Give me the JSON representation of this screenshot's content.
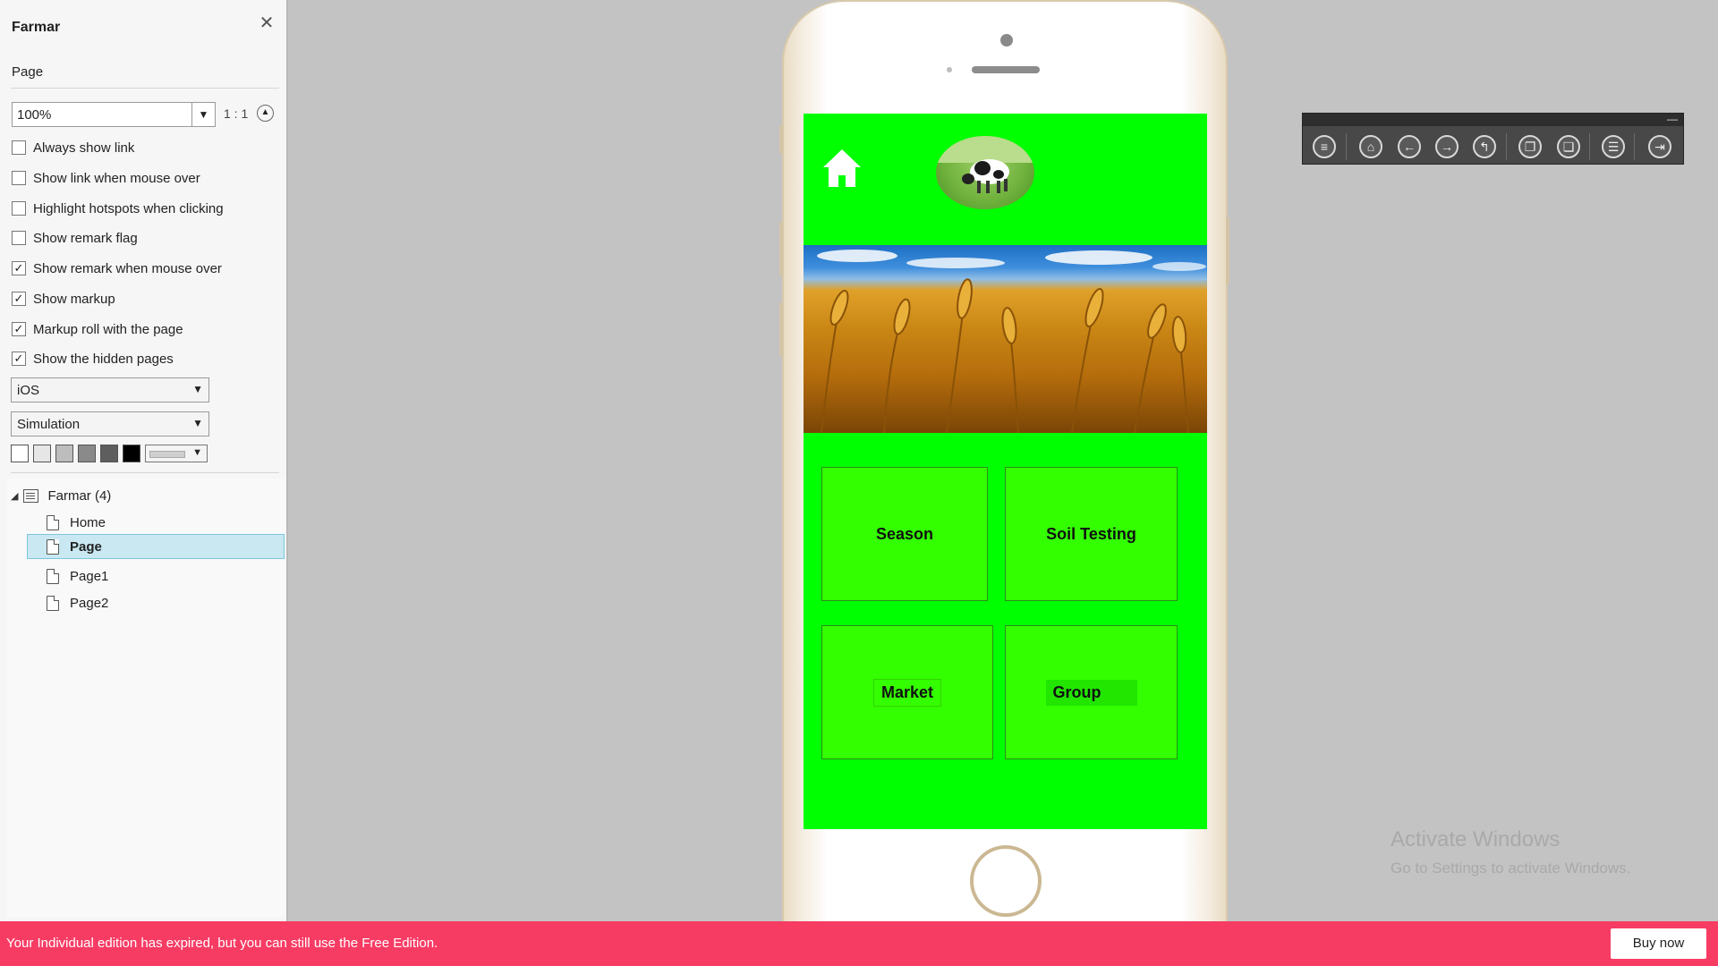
{
  "panel": {
    "title": "Farmar",
    "section": "Page",
    "zoom": "100%",
    "ratio": "1 : 1",
    "options": [
      {
        "label": "Always show link",
        "checked": false
      },
      {
        "label": "Show link when mouse over",
        "checked": false
      },
      {
        "label": "Highlight hotspots when clicking",
        "checked": false
      },
      {
        "label": "Show remark flag",
        "checked": false
      },
      {
        "label": "Show remark when mouse over",
        "checked": true
      },
      {
        "label": "Show markup",
        "checked": true
      },
      {
        "label": "Markup roll with the page",
        "checked": true
      },
      {
        "label": "Show the hidden pages",
        "checked": true
      }
    ],
    "device": "iOS",
    "mode": "Simulation",
    "swatch_colors": [
      "#ffffff",
      "#e6e6e6",
      "#bdbdbd",
      "#8a8a8a",
      "#5e5e5e",
      "#000000"
    ]
  },
  "tree": {
    "root": "Farmar (4)",
    "pages": [
      "Home",
      "Page",
      "Page1",
      "Page2"
    ],
    "selected": "Page"
  },
  "app": {
    "tiles": {
      "season": "Season",
      "soil": "Soil Testing",
      "market": "Market",
      "group": "Group"
    },
    "accent": "#00ff00"
  },
  "toolbar": {
    "icons": [
      "menu-icon",
      "home-icon",
      "back-arrow-icon",
      "forward-arrow-icon",
      "return-icon",
      "copy-icon",
      "paste-icon",
      "document-icon",
      "exit-icon"
    ]
  },
  "watermark": {
    "line1": "Activate Windows",
    "line2": "Go to Settings to activate Windows."
  },
  "banner": {
    "message": "Your Individual edition has expired, but you can still use the Free Edition.",
    "button": "Buy now"
  }
}
